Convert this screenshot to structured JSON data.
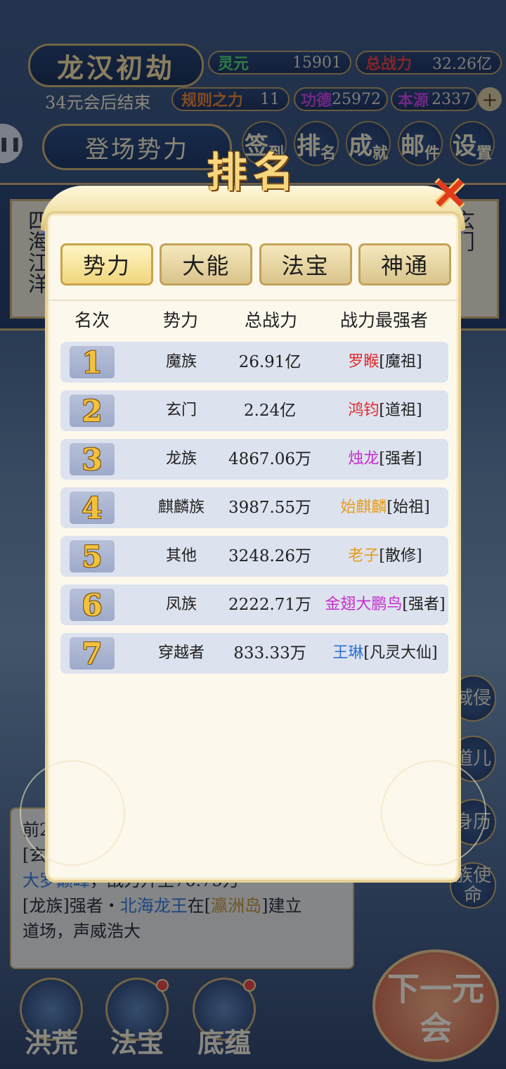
{
  "colors": {
    "red": "#e02a2a",
    "magenta": "#c62ecf",
    "orange": "#e79b18",
    "blue": "#2d72d2",
    "black": "#1f1f1f",
    "rank_gold": "#f3c13c"
  },
  "hud": {
    "realm_title": "龙汉初劫",
    "countdown": "34元会后结束",
    "lingyuan_label": "灵元",
    "lingyuan_value": "15901",
    "total_power_label": "总战力",
    "total_power_value": "32.26亿",
    "rule_power_label": "规则之力",
    "rule_power_value": "11",
    "merit_label": "功德",
    "merit_value": "25972",
    "origin_label": "本源",
    "origin_value": "2337",
    "plus_icon": "+",
    "faction_button": "登场势力",
    "menu": [
      {
        "main": "签",
        "sub": "到"
      },
      {
        "main": "排",
        "sub": "名"
      },
      {
        "main": "成",
        "sub": "就"
      },
      {
        "main": "邮",
        "sub": "件"
      },
      {
        "main": "设",
        "sub": "置"
      }
    ],
    "map_left": "四海江洋",
    "map_right": "玄门",
    "right_buttons": [
      "域侵",
      "道儿",
      "身历",
      "族使命"
    ]
  },
  "log": {
    "line1": "前2",
    "line2": "[玄",
    "line3_blue": "大罗巅峰",
    "line3_rest": "，战力升至76.75万",
    "line4_a": "[龙族]强者・",
    "line4_blue": "北海龙王",
    "line4_b": "在[",
    "line4_gold": "瀛洲岛",
    "line4_c": "]建立",
    "line5": "道场，声威浩大"
  },
  "bottom_nav": [
    "洪荒",
    "法宝",
    "底蕴"
  ],
  "next_button": "下一元会",
  "modal": {
    "title": "排名",
    "close_icon": "✕",
    "tabs": [
      {
        "label": "势力",
        "active": true
      },
      {
        "label": "大能",
        "active": false
      },
      {
        "label": "法宝",
        "active": false
      },
      {
        "label": "神通",
        "active": false
      }
    ],
    "columns": {
      "rank": "名次",
      "faction": "势力",
      "power": "总战力",
      "top": "战力最强者"
    },
    "rows": [
      {
        "rank": "1",
        "faction": "魔族",
        "power": "26.91亿",
        "top_name": "罗睺",
        "top_title": "[魔祖]",
        "name_color": "#e02a2a"
      },
      {
        "rank": "2",
        "faction": "玄门",
        "power": "2.24亿",
        "top_name": "鸿钧",
        "top_title": "[道祖]",
        "name_color": "#e02a2a"
      },
      {
        "rank": "3",
        "faction": "龙族",
        "power": "4867.06万",
        "top_name": "烛龙",
        "top_title": "[强者]",
        "name_color": "#c62ecf"
      },
      {
        "rank": "4",
        "faction": "麒麟族",
        "power": "3987.55万",
        "top_name": "始麒麟",
        "top_title": "[始祖]",
        "name_color": "#e79b18"
      },
      {
        "rank": "5",
        "faction": "其他",
        "power": "3248.26万",
        "top_name": "老子",
        "top_title": "[散修]",
        "name_color": "#e79b18"
      },
      {
        "rank": "6",
        "faction": "凤族",
        "power": "2222.71万",
        "top_name": "金翅大鹏鸟",
        "top_title": "[强者]",
        "name_color": "#c62ecf"
      },
      {
        "rank": "7",
        "faction": "穿越者",
        "power": "833.33万",
        "top_name": "王琳",
        "top_title": "[凡灵大仙]",
        "name_color": "#2d72d2"
      }
    ]
  }
}
